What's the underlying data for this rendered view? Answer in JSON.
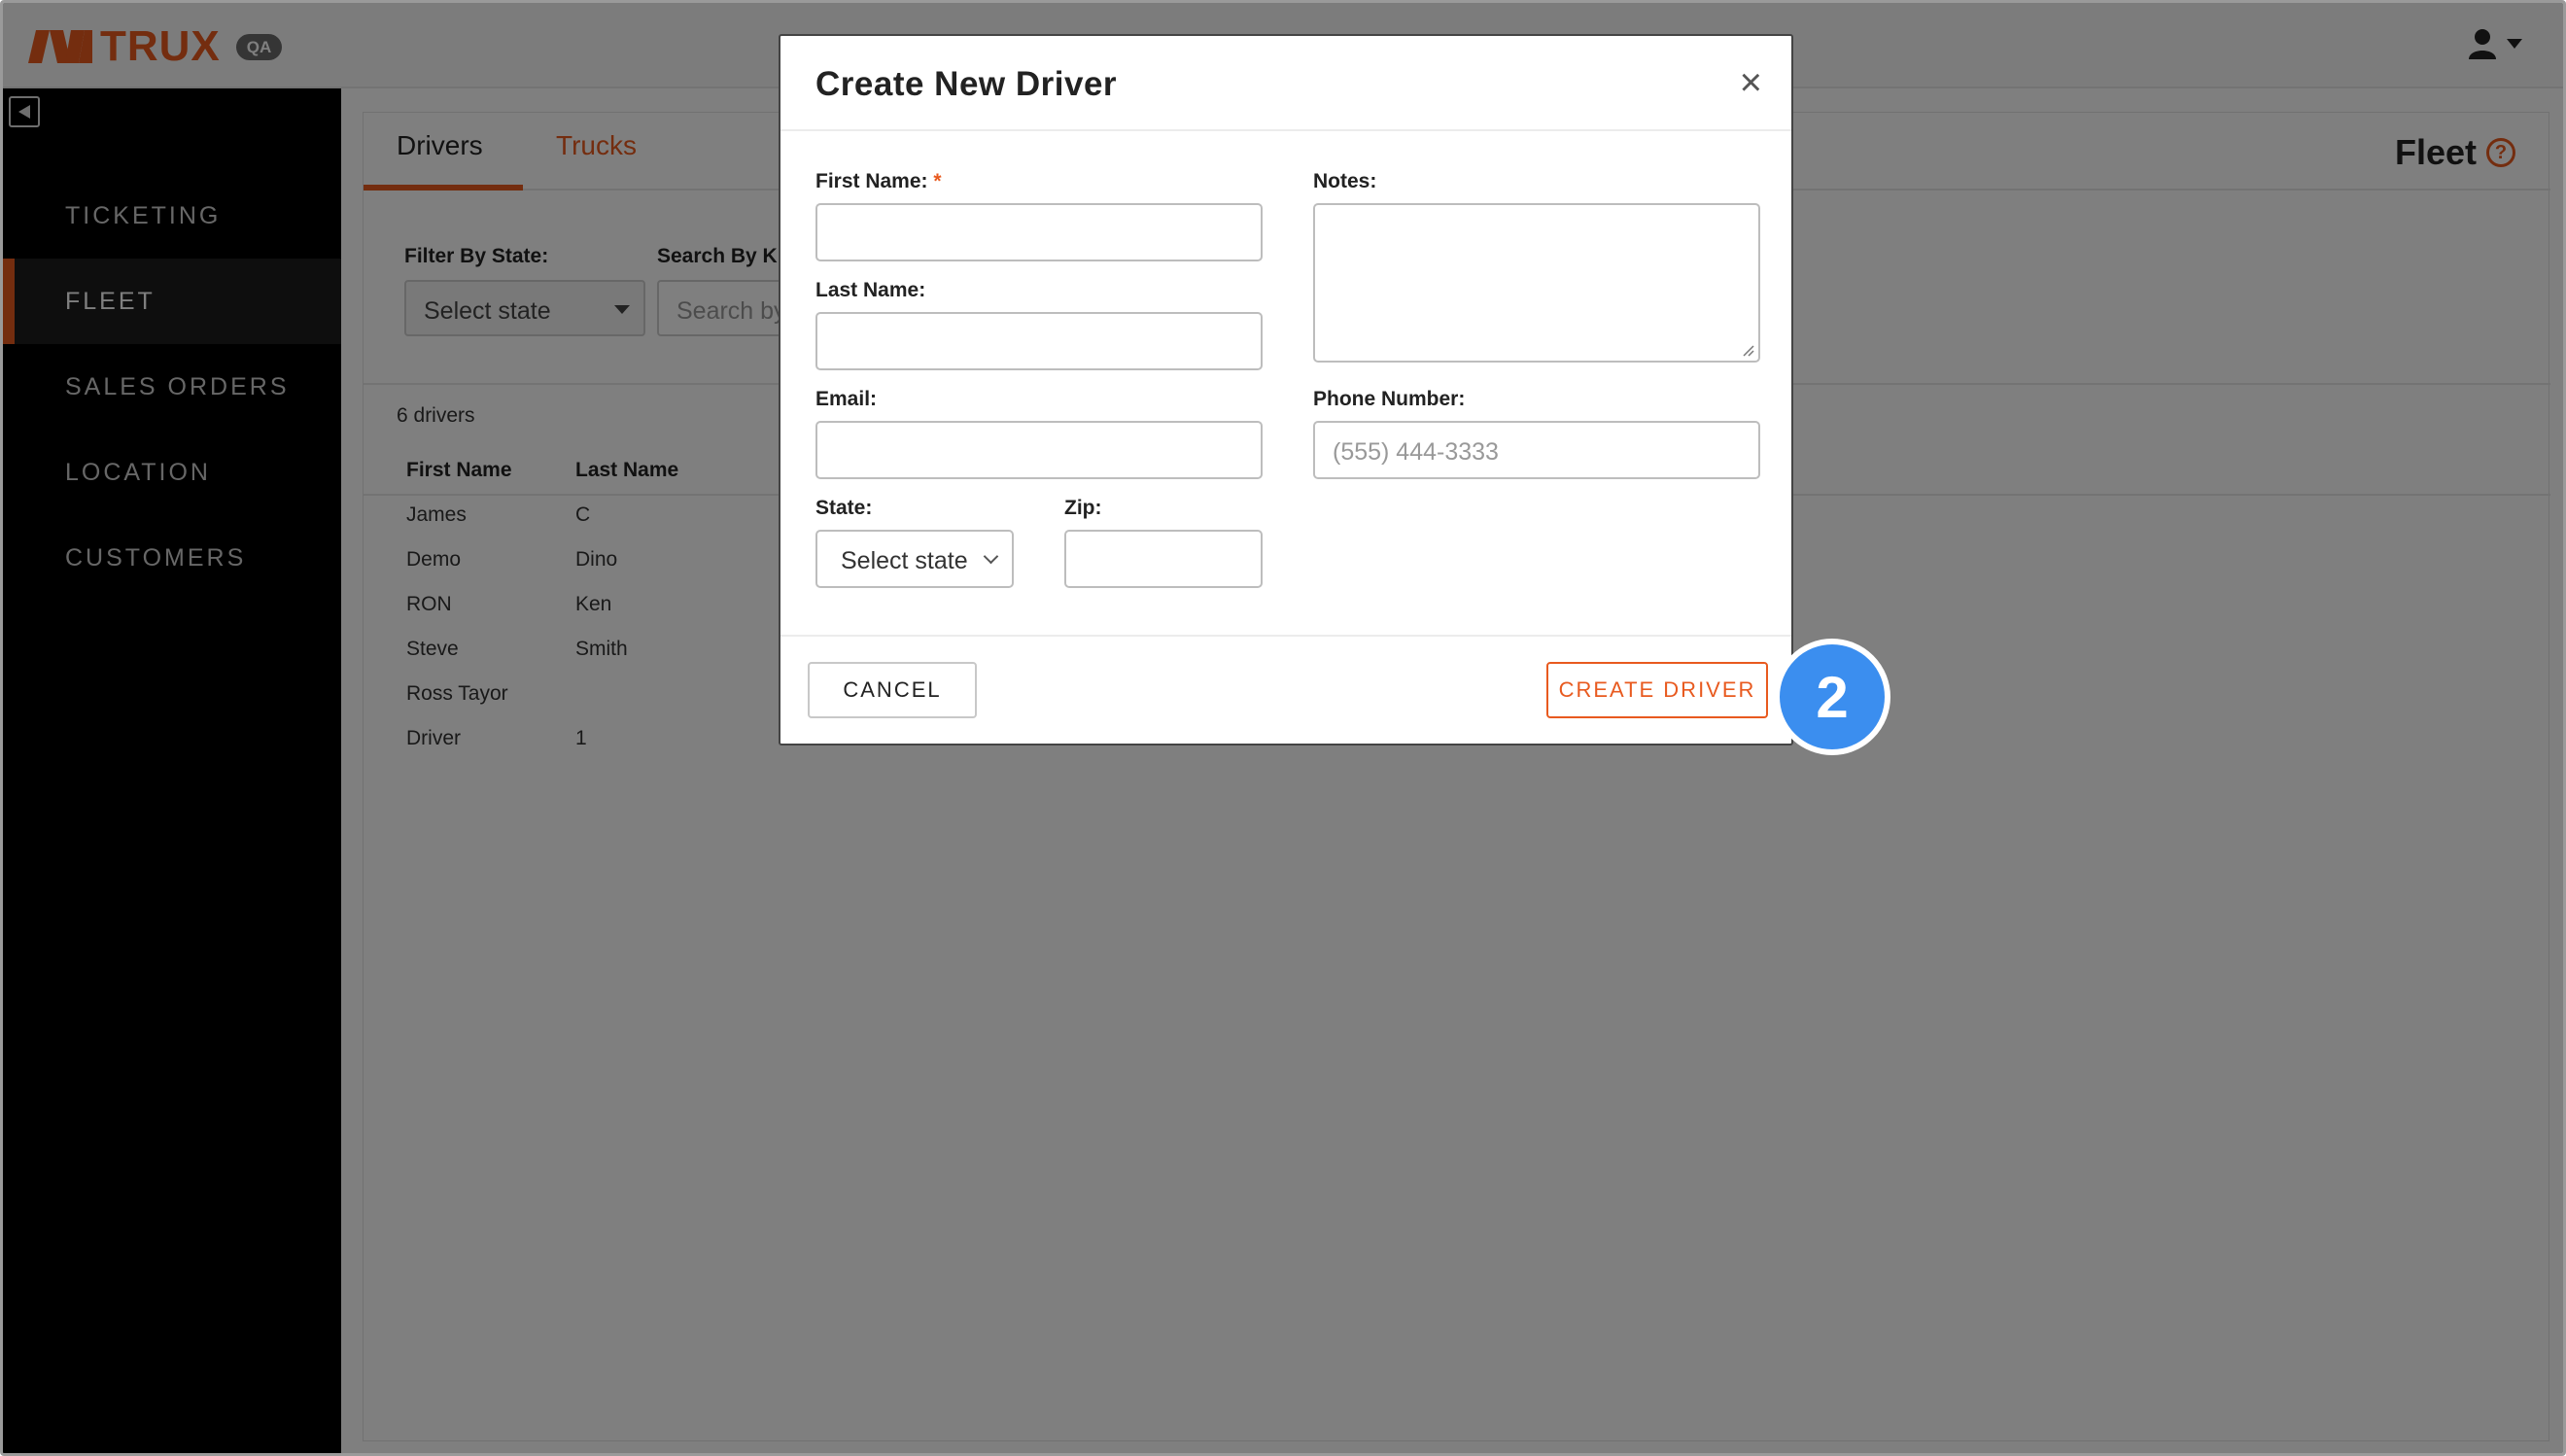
{
  "header": {
    "brand": "TRUX",
    "env_badge": "QA",
    "user_icon": "user-icon"
  },
  "sidebar": {
    "items": [
      {
        "label": "TICKETING",
        "active": false
      },
      {
        "label": "FLEET",
        "active": true
      },
      {
        "label": "SALES ORDERS",
        "active": false
      },
      {
        "label": "LOCATION",
        "active": false
      },
      {
        "label": "CUSTOMERS",
        "active": false
      }
    ]
  },
  "main": {
    "tabs": [
      {
        "label": "Drivers",
        "active": true
      },
      {
        "label": "Trucks",
        "active": false
      }
    ],
    "page_title": "Fleet",
    "help_glyph": "?",
    "filter_state_label": "Filter By State:",
    "filter_state_value": "Select state",
    "search_label": "Search By K",
    "search_placeholder": "Search by",
    "count_text": "6 drivers",
    "columns": [
      "First Name",
      "Last Name"
    ],
    "rows": [
      {
        "first": "James",
        "last": "C"
      },
      {
        "first": "Demo",
        "last": "Dino"
      },
      {
        "first": "RON",
        "last": "Ken"
      },
      {
        "first": "Steve",
        "last": "Smith"
      },
      {
        "first": "Ross Tayor",
        "last": ""
      },
      {
        "first": "Driver",
        "last": "1"
      }
    ]
  },
  "modal": {
    "title": "Create New Driver",
    "close_glyph": "×",
    "first_name_label": "First Name:",
    "required_mark": "*",
    "last_name_label": "Last Name:",
    "email_label": "Email:",
    "state_label": "State:",
    "state_value": "Select state",
    "zip_label": "Zip:",
    "notes_label": "Notes:",
    "phone_label": "Phone Number:",
    "phone_placeholder": "(555) 444-3333",
    "cancel_label": "CANCEL",
    "create_label": "CREATE DRIVER"
  },
  "annotation": {
    "step_number": "2"
  },
  "colors": {
    "accent": "#e85a1f",
    "sidebar_bg": "#000000",
    "step_badge": "#3b8eef"
  }
}
